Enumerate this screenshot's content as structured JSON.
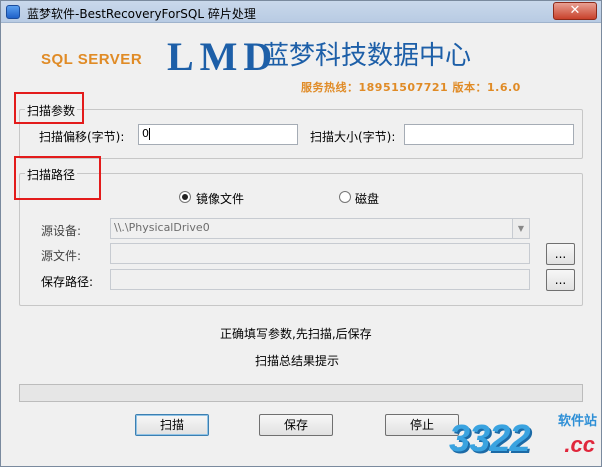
{
  "window": {
    "title": "蓝梦软件-BestRecoveryForSQL 碎片处理",
    "close_glyph": "✕"
  },
  "brand": {
    "sql_label": "SQL SERVER",
    "logo": "LMD",
    "title": "蓝梦科技数据中心",
    "hotline": "服务热线：18951507721  版本：1.6.0"
  },
  "scan_params": {
    "legend": "扫描参数",
    "offset_label": "扫描偏移(字节):",
    "offset_value": "0",
    "size_label": "扫描大小(字节):",
    "size_value": ""
  },
  "scan_path": {
    "legend": "扫描路径",
    "option_image": "镜像文件",
    "option_disk": "磁盘",
    "selected": "镜像文件",
    "source_device_label": "源设备:",
    "source_device_value": "\\\\.\\PhysicalDrive0",
    "source_file_label": "源文件:",
    "source_file_value": "",
    "save_path_label": "保存路径:",
    "save_path_value": "",
    "browse_label": "..."
  },
  "status": {
    "hint": "正确填写参数,先扫描,后保存",
    "result": "扫描总结果提示",
    "progress_percent": 0
  },
  "actions": {
    "scan": "扫描",
    "save": "保存",
    "stop": "停止"
  },
  "watermark": {
    "number": "3322",
    "soft": "软件站",
    "cc": ".cc"
  },
  "colors": {
    "brand_blue": "#1d5fa8",
    "brand_orange": "#e08b26",
    "highlight_red": "#e31b1b"
  }
}
